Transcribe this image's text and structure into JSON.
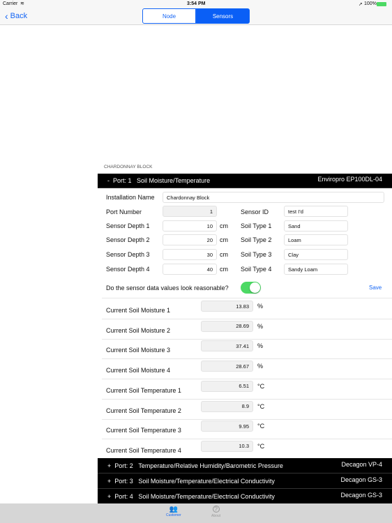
{
  "status": {
    "carrier": "Carrier",
    "time": "3:54 PM",
    "battery": "100%"
  },
  "nav": {
    "back": "Back",
    "segments": [
      "Node",
      "Sensors"
    ],
    "selected": "Sensors"
  },
  "section_title": "CHARDONNAY BLOCK",
  "port1": {
    "toggle": "-",
    "port": "Port: 1",
    "type": "Soil Moisture/Temperature",
    "model": "Enviropro EP100DL-04"
  },
  "form": {
    "installation_name_label": "Installation Name",
    "installation_name": "Chardonnay Block",
    "port_number_label": "Port Number",
    "port_number": "1",
    "sensor_id_label": "Sensor ID",
    "sensor_id": "test I'd",
    "unit": "cm",
    "depths": [
      {
        "label": "Sensor Depth 1",
        "value": "10"
      },
      {
        "label": "Sensor Depth 2",
        "value": "20"
      },
      {
        "label": "Sensor Depth 3",
        "value": "30"
      },
      {
        "label": "Sensor Depth 4",
        "value": "40"
      }
    ],
    "soil_types": [
      {
        "label": "Soil Type 1",
        "value": "Sand"
      },
      {
        "label": "Soil Type 2",
        "value": "Loam"
      },
      {
        "label": "Soil Type 3",
        "value": "Clay"
      },
      {
        "label": "Soil Type 4",
        "value": "Sandy Loam"
      }
    ],
    "question": "Do the sensor data values look reasonable?",
    "reasonable": true,
    "save": "Save"
  },
  "readings": [
    {
      "label": "Current Soil Moisture 1",
      "value": "13.83",
      "unit": "%"
    },
    {
      "label": "Current Soil Moisture 2",
      "value": "28.69",
      "unit": "%"
    },
    {
      "label": "Current Soil Moisture 3",
      "value": "37.41",
      "unit": "%"
    },
    {
      "label": "Current Soil Moisture 4",
      "value": "28.67",
      "unit": "%"
    },
    {
      "label": "Current Soil Temperature 1",
      "value": "6.51",
      "unit": "°C"
    },
    {
      "label": "Current Soil Temperature 2",
      "value": "8.9",
      "unit": "°C"
    },
    {
      "label": "Current Soil Temperature 3",
      "value": "9.95",
      "unit": "°C"
    },
    {
      "label": "Current Soil Temperature 4",
      "value": "10.3",
      "unit": "°C"
    }
  ],
  "other_ports": [
    {
      "toggle": "+",
      "port": "Port: 2",
      "type": "Temperature/Relative Humidity/Barometric Pressure",
      "model": "Decagon VP-4"
    },
    {
      "toggle": "+",
      "port": "Port: 3",
      "type": "Soil Moisture/Temperature/Electrical Conductivity",
      "model": "Decagon GS-3"
    },
    {
      "toggle": "+",
      "port": "Port: 4",
      "type": "Soil Moisture/Temperature/Electrical Conductivity",
      "model": "Decagon GS-3"
    }
  ],
  "tabbar": {
    "items": [
      {
        "label": "Customer",
        "icon": "customer-icon"
      },
      {
        "label": "About",
        "icon": "question-icon"
      }
    ],
    "active": "Customer"
  },
  "colors": {
    "accent": "#0a5ff6",
    "toggle_on": "#4cd964"
  }
}
